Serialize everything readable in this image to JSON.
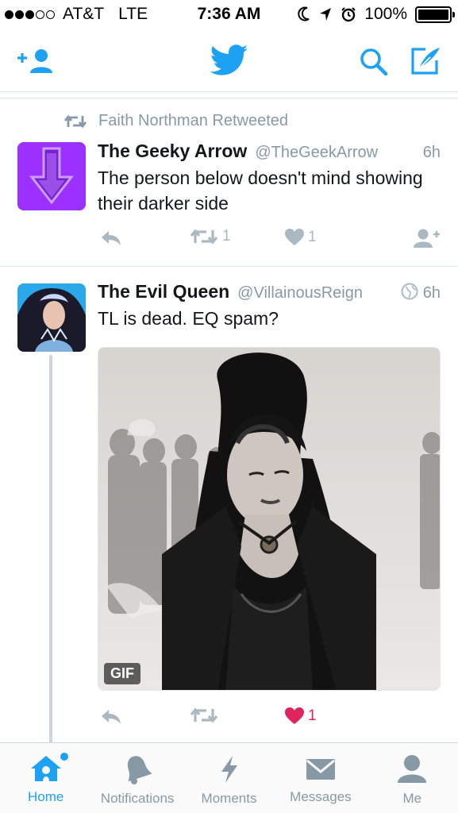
{
  "status_bar": {
    "carrier": "AT&T",
    "network": "LTE",
    "time": "7:36 AM",
    "battery": "100%",
    "signal_bars_filled": 3,
    "signal_bars_total": 5
  },
  "nav": {
    "logo_icon": "twitter-bird-icon",
    "left_icon": "add-user-icon",
    "search_icon": "search-icon",
    "compose_icon": "compose-icon"
  },
  "tweets": [
    {
      "retweeted_by": "Faith Northman Retweeted",
      "display_name": "The Geeky Arrow",
      "handle": "@TheGeekArrow",
      "time": "6h",
      "text": "The person below doesn't mind showing their darker side",
      "retweet_count": "1",
      "like_count": "1",
      "liked": false
    },
    {
      "display_name": "The Evil Queen",
      "handle": "@VillainousReign",
      "time": "6h",
      "text": "TL is dead. EQ spam?",
      "media_badge": "GIF",
      "retweet_count": "",
      "like_count": "1",
      "liked": true
    }
  ],
  "tabs": [
    {
      "label": "Home",
      "icon": "home-icon",
      "active": true,
      "has_badge": true
    },
    {
      "label": "Notifications",
      "icon": "bell-icon",
      "active": false
    },
    {
      "label": "Moments",
      "icon": "lightning-icon",
      "active": false
    },
    {
      "label": "Messages",
      "icon": "envelope-icon",
      "active": false
    },
    {
      "label": "Me",
      "icon": "person-icon",
      "active": false
    }
  ],
  "colors": {
    "accent": "#1da1f2",
    "like_active": "#e0245e",
    "muted": "#8899a6",
    "action_icon": "#aab8c2",
    "avatar_purple": "#9b30ff"
  }
}
